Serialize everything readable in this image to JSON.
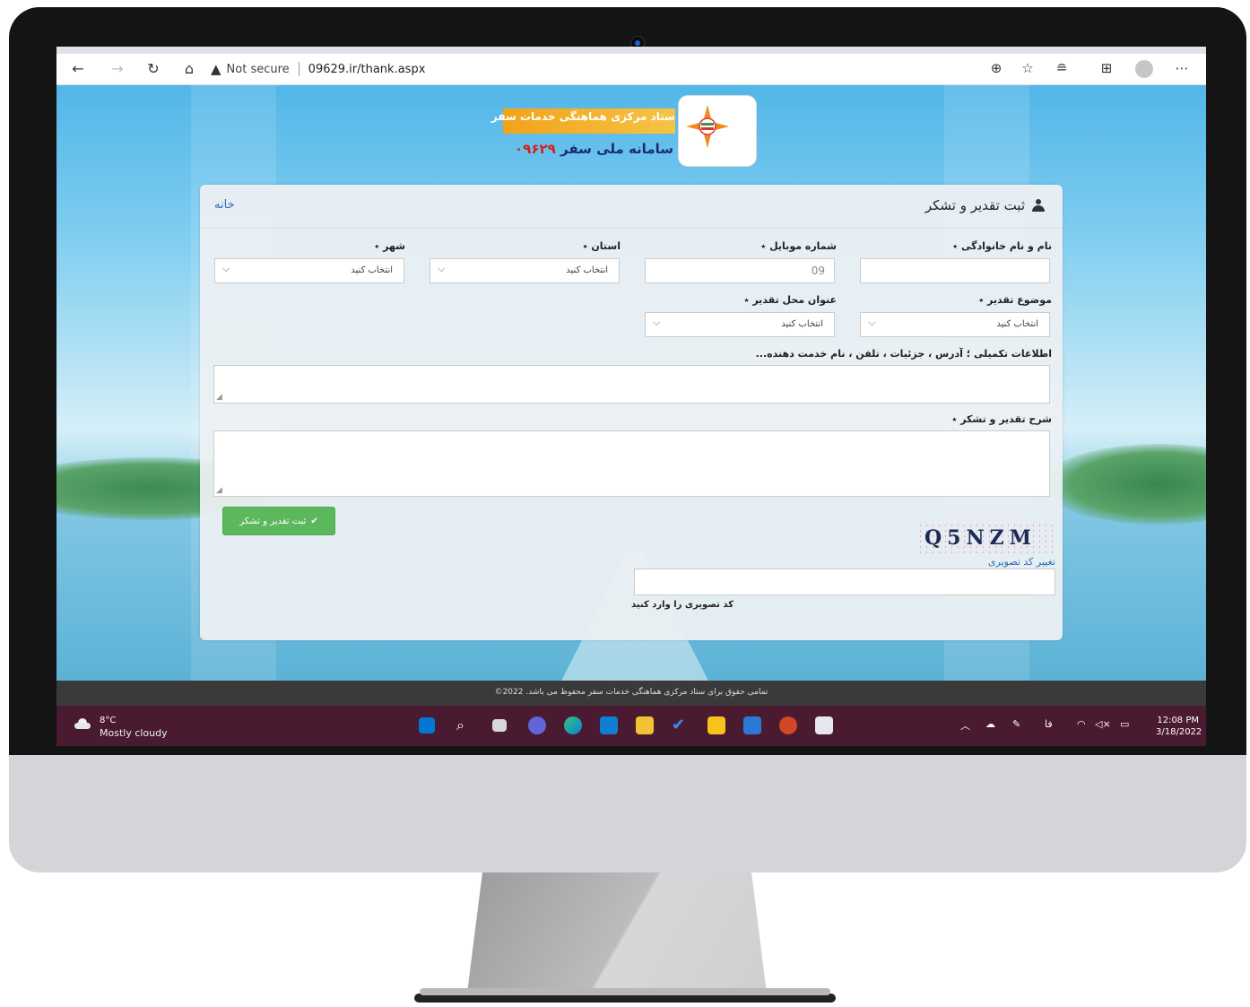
{
  "browser": {
    "security_label": "Not secure",
    "url": "09629.ir/thank.aspx",
    "icons": [
      "back-icon",
      "forward-icon",
      "refresh-icon",
      "home-icon",
      "warning-icon",
      "zoom-icon",
      "add-favorite-icon",
      "favorites-icon",
      "collections-icon",
      "profile-icon",
      "more-icon"
    ]
  },
  "header": {
    "logo_title": "ستاد مرکزی هماهنگی خدمات سفر",
    "logo_subtitle": "سامانه ملی سفر",
    "logo_number": "۰۹۶۲۹"
  },
  "form": {
    "title": "ثبت تقدیر و تشکر",
    "home_link": "خانه",
    "fields": {
      "full_name": {
        "label": "نام و نام خانوادگی ٭",
        "value": ""
      },
      "mobile": {
        "label": "شماره موبایل ٭",
        "value": "09"
      },
      "province": {
        "label": "استان ٭",
        "value": "انتخاب کنید"
      },
      "city": {
        "label": "شهر ٭",
        "value": "انتخاب کنید"
      },
      "subject": {
        "label": "موضوع تقدیر ٭",
        "value": "انتخاب کنید"
      },
      "place_title": {
        "label": "عنوان محل تقدیر ٭",
        "value": "انتخاب کنید"
      },
      "extra_info": {
        "label": "اطلاعات تکمیلی ؛ آدرس ، جزئیات ، تلفن ، نام خدمت دهنده..."
      },
      "description": {
        "label": "شرح تقدیر و تشکر ٭"
      }
    },
    "submit_label": "ثبت تقدیر و تشکر",
    "captcha_text": "Q5NZM",
    "change_captcha": "تغییر کد تصویری",
    "captcha_label": "کد تصویری را وارد کنید"
  },
  "footer": {
    "text": "تمامی حقوق برای ستاد مرکزی هماهنگی خدمات سفر محفوظ می باشد. 2022©"
  },
  "taskbar": {
    "temperature": "8°C",
    "condition": "Mostly cloudy",
    "language": "فا",
    "time": "12:08 PM",
    "date": "3/18/2022"
  },
  "colors": {
    "submit_green": "#5cb85c",
    "link_blue": "#2a6db5",
    "taskbar": "#4a1a30",
    "footer": "#3a3a3a"
  }
}
